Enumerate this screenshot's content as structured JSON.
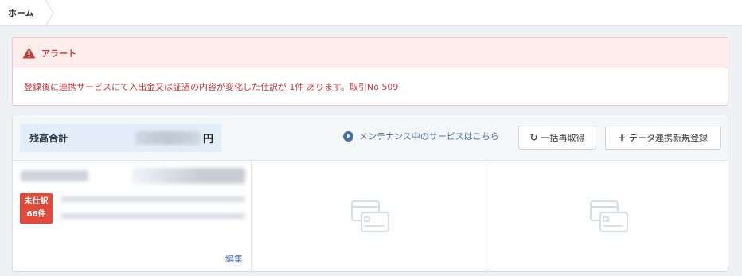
{
  "breadcrumb": {
    "home": "ホーム"
  },
  "alert": {
    "title": "アラート",
    "message": "登録後に連携サービスにて入出金又は証憑の内容が変化した仕訳が 1件 あります。取引No 509"
  },
  "summary": {
    "balance_label": "残高合計",
    "balance_unit": "円"
  },
  "actions": {
    "maintenance_link": "メンテナンス中のサービスはこちら",
    "refetch_button": "一括再取得",
    "add_button": "データ連携新規登録"
  },
  "account_card": {
    "badge_line1": "未仕訳",
    "badge_line2": "66件",
    "edit_link": "編集"
  },
  "colors": {
    "alert_red": "#c73b3b",
    "badge_red": "#e04a3a",
    "link_blue": "#4a6fa5",
    "balance_bg": "#e2edf9"
  },
  "icons": [
    "warning-icon",
    "play-circle-icon",
    "refresh-icon",
    "plus-icon",
    "card-placeholder-icon"
  ]
}
